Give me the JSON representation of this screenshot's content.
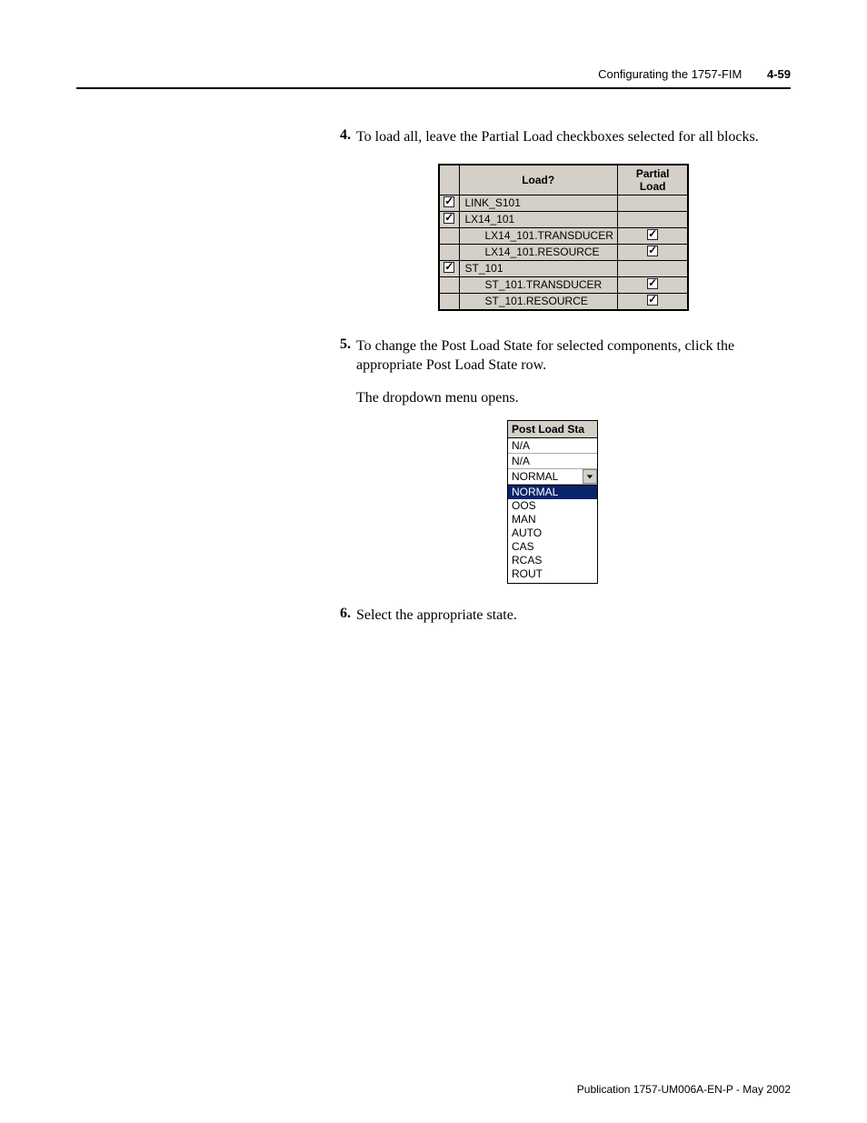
{
  "header": {
    "title": "Configurating the 1757-FIM",
    "pagenum": "4-59"
  },
  "steps": {
    "s4": {
      "num": "4.",
      "text": "To load all, leave the Partial Load checkboxes selected for all blocks."
    },
    "s5": {
      "num": "5.",
      "text": "To change the Post Load State for selected components, click the appropriate Post Load State row."
    },
    "s5_para": "The dropdown menu opens.",
    "s6": {
      "num": "6.",
      "text": "Select the appropriate state."
    }
  },
  "table": {
    "headers": {
      "load": "Load?",
      "partial": "Partial Load"
    },
    "rows": [
      {
        "type": "parent",
        "checked": true,
        "label": "LINK_S101",
        "partial": ""
      },
      {
        "type": "parent",
        "checked": true,
        "label": "LX14_101",
        "partial": ""
      },
      {
        "type": "child",
        "label": "LX14_101.TRANSDUCER",
        "partial": true
      },
      {
        "type": "child",
        "label": "LX14_101.RESOURCE",
        "partial": true
      },
      {
        "type": "parent",
        "checked": true,
        "label": "ST_101",
        "partial": ""
      },
      {
        "type": "child",
        "label": "ST_101.TRANSDUCER",
        "partial": true
      },
      {
        "type": "child",
        "label": "ST_101.RESOURCE",
        "partial": true
      }
    ]
  },
  "dropdown": {
    "header": "Post Load Sta",
    "rowsAbove": [
      "N/A",
      "N/A"
    ],
    "comboValue": "NORMAL",
    "options": [
      "NORMAL",
      "OOS",
      "MAN",
      "AUTO",
      "CAS",
      "RCAS",
      "ROUT"
    ],
    "selected": "NORMAL"
  },
  "footer": "Publication 1757-UM006A-EN-P - May 2002"
}
